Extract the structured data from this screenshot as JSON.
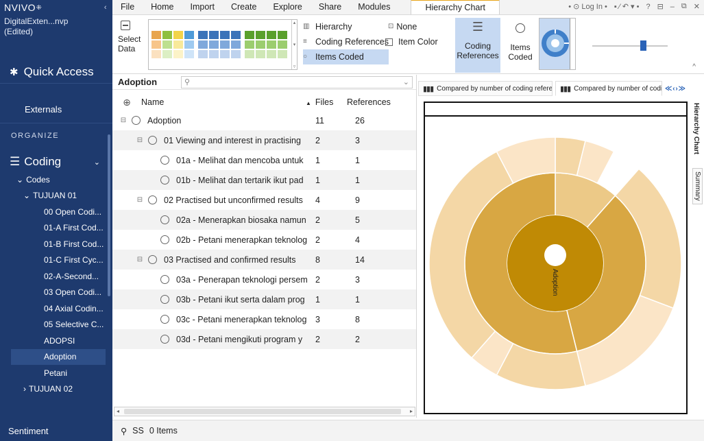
{
  "app": {
    "brand": "NVIVO",
    "project": "DigitalExten...nvp",
    "project_state": "(Edited)"
  },
  "sidebar": {
    "quick_access": "Quick Access",
    "externals": "Externals",
    "organize": "ORGANIZE",
    "coding": "Coding",
    "items": [
      {
        "label": "Codes",
        "level": 1,
        "toggle": "v"
      },
      {
        "label": "TUJUAN 01",
        "level": 2,
        "toggle": "v"
      },
      {
        "label": "00 Open Codi...",
        "level": 3
      },
      {
        "label": "01-A First Cod...",
        "level": 3
      },
      {
        "label": "01-B First Cod...",
        "level": 3
      },
      {
        "label": "01-C First Cyc...",
        "level": 3
      },
      {
        "label": "02-A-Second...",
        "level": 3
      },
      {
        "label": "03 Open Codi...",
        "level": 3
      },
      {
        "label": "04 Axial Codin...",
        "level": 3
      },
      {
        "label": "05 Selective C...",
        "level": 3
      },
      {
        "label": "ADOPSI",
        "level": 3
      },
      {
        "label": "Adoption",
        "level": 3,
        "selected": true
      },
      {
        "label": "Petani",
        "level": 3
      },
      {
        "label": "TUJUAN 02",
        "level": 2,
        "toggle": ">"
      }
    ],
    "sentiment": "Sentiment"
  },
  "ribbon_tabs": [
    "File",
    "Home",
    "Import",
    "Create",
    "Explore",
    "Share",
    "Modules",
    "Hierarchy Chart"
  ],
  "window": {
    "login": "Log In"
  },
  "ribbon": {
    "select_data": "Select Data",
    "hierarchy": "Hierarchy",
    "coding_references_opt": "Coding References",
    "items_coded_opt": "Items Coded",
    "none": "None",
    "item_color": "Item Color",
    "coding_references_btn": "Coding References",
    "items_coded_btn": "Items Coded"
  },
  "list": {
    "title": "Adoption",
    "search_placeholder": "",
    "col_name": "Name",
    "col_files": "Files",
    "col_refs": "References",
    "rows": [
      {
        "name": "Adoption",
        "files": "11",
        "refs": "26",
        "depth": 0,
        "toggle": true
      },
      {
        "name": "01 Viewing and interest in practising",
        "files": "2",
        "refs": "3",
        "depth": 1,
        "toggle": true
      },
      {
        "name": "01a - Melihat dan mencoba untuk",
        "files": "1",
        "refs": "1",
        "depth": 2
      },
      {
        "name": "01b - Melihat dan tertarik ikut pad",
        "files": "1",
        "refs": "1",
        "depth": 2
      },
      {
        "name": "02 Practised but unconfirmed results",
        "files": "4",
        "refs": "9",
        "depth": 1,
        "toggle": true
      },
      {
        "name": "02a - Menerapkan biosaka namun",
        "files": "2",
        "refs": "5",
        "depth": 2
      },
      {
        "name": "02b - Petani menerapkan teknolog",
        "files": "2",
        "refs": "4",
        "depth": 2
      },
      {
        "name": "03 Practised and confirmed results",
        "files": "8",
        "refs": "14",
        "depth": 1,
        "toggle": true
      },
      {
        "name": "03a - Penerapan teknologi persem",
        "files": "2",
        "refs": "3",
        "depth": 2
      },
      {
        "name": "03b - Petani ikut serta dalam prog",
        "files": "1",
        "refs": "1",
        "depth": 2
      },
      {
        "name": "03c - Petani menerapkan teknolog",
        "files": "3",
        "refs": "8",
        "depth": 2
      },
      {
        "name": "03d - Petani mengikuti program y",
        "files": "2",
        "refs": "2",
        "depth": 2
      }
    ]
  },
  "chart_tabs": [
    "Compared by number of coding references",
    "Compared by number of coding refere"
  ],
  "chart": {
    "center_label": "Adoption",
    "colors": {
      "center": "#c08a05",
      "ring1": "#d8a743",
      "ring1_alt": "#ecc987",
      "ring2": "#f4d7a6",
      "ring2_light": "#fbe5c7"
    }
  },
  "side_tabs": [
    "Hierarchy Chart",
    "Summary"
  ],
  "status": {
    "user": "SS",
    "items": "0 Items"
  }
}
